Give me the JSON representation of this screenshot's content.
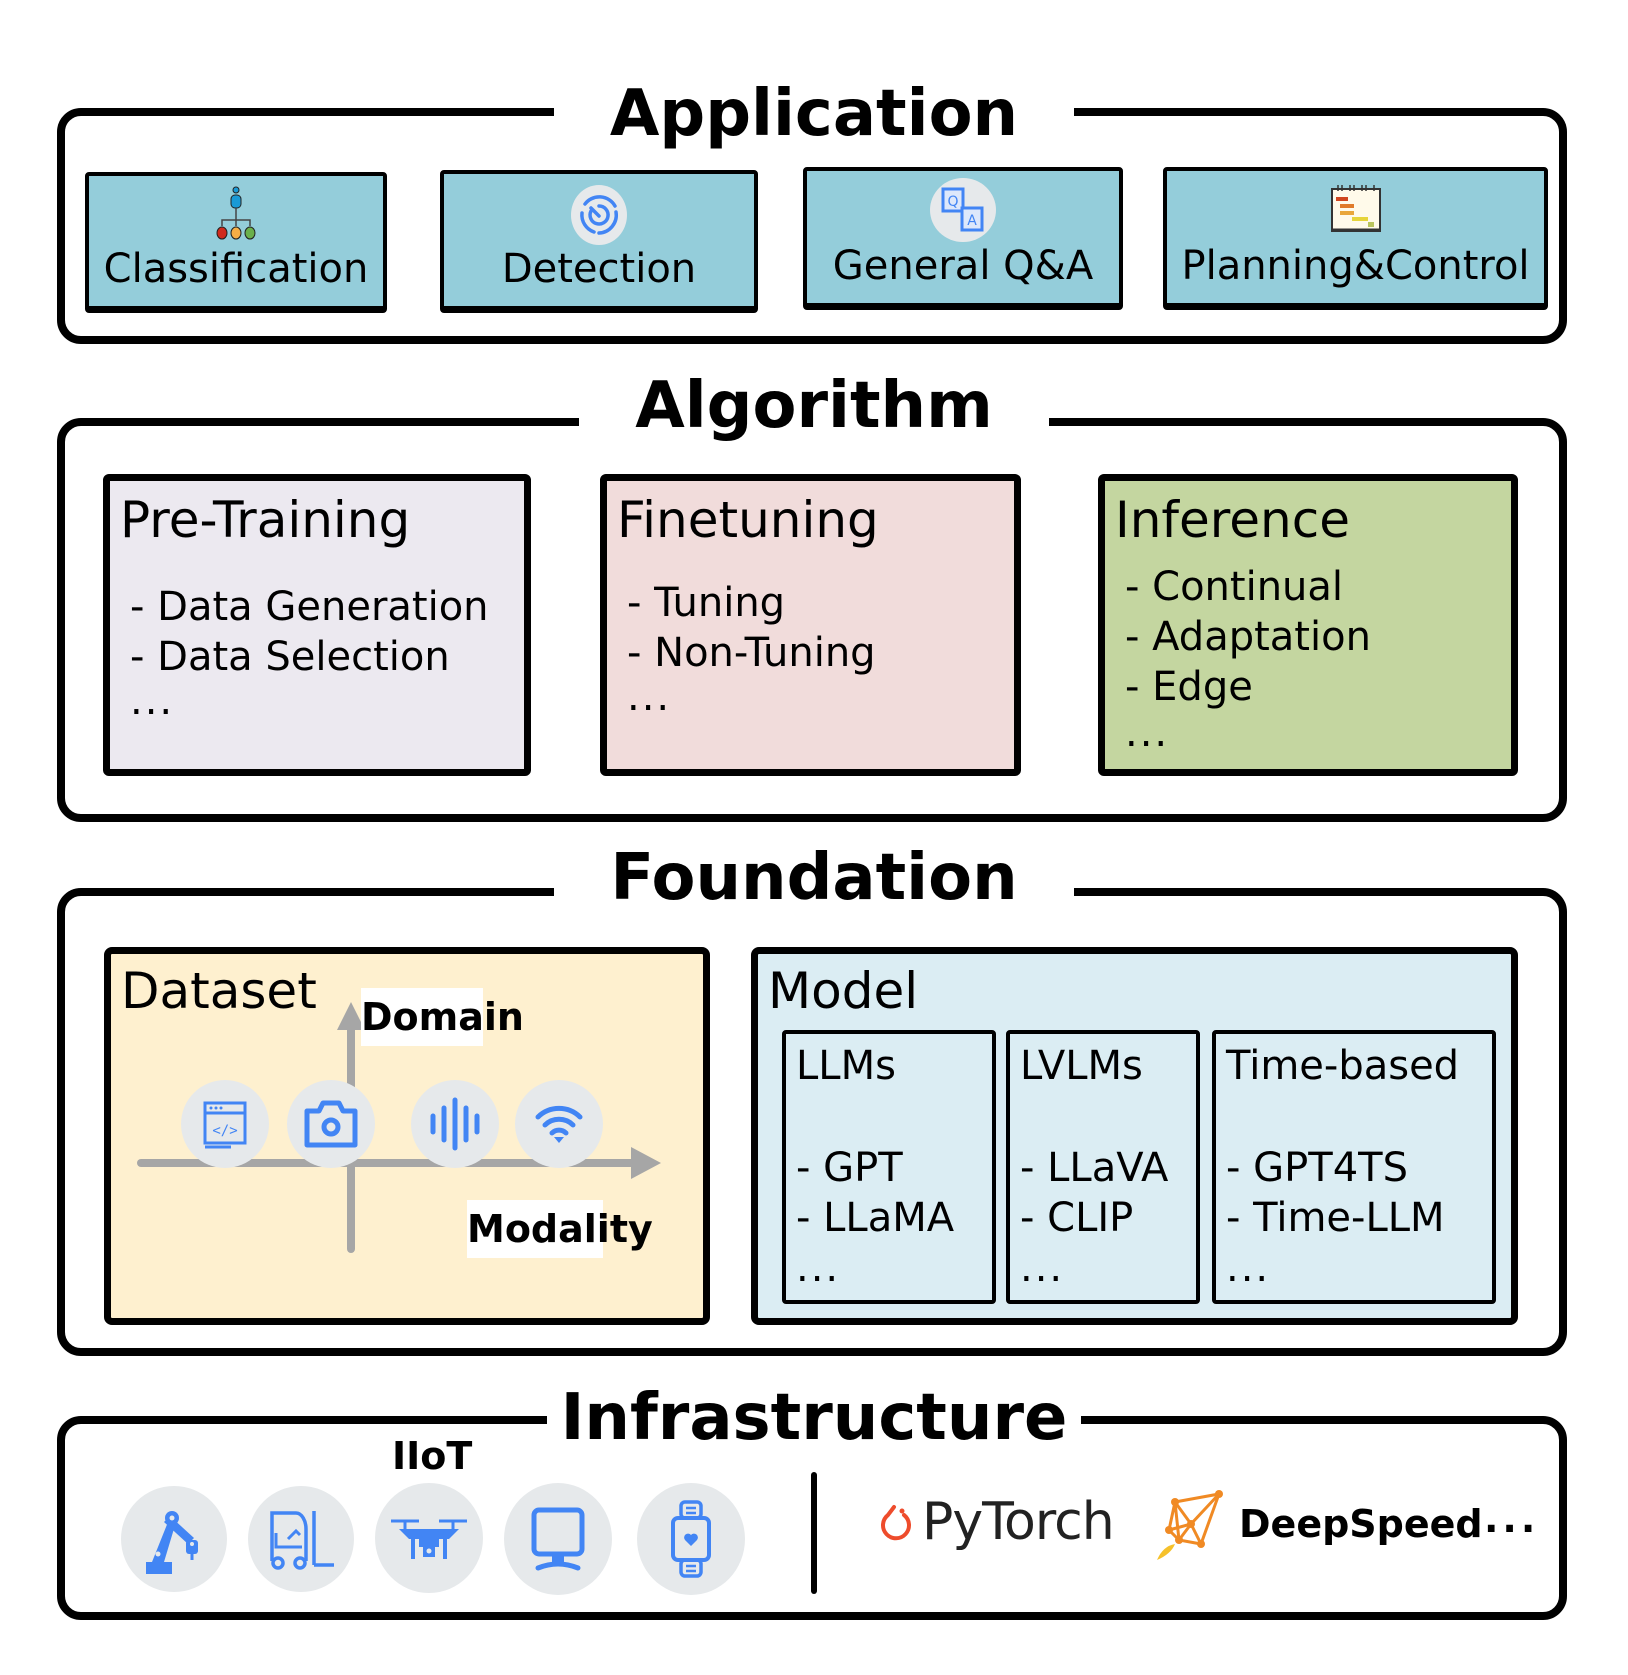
{
  "layers": {
    "application": {
      "title": "Application",
      "items": [
        {
          "label": "Classification",
          "icon": "hierarchy-tree-icon"
        },
        {
          "label": "Detection",
          "icon": "radar-icon"
        },
        {
          "label": "General Q&A",
          "icon": "qa-icon"
        },
        {
          "label": "Planning&Control",
          "icon": "gantt-chart-icon"
        }
      ]
    },
    "algorithm": {
      "title": "Algorithm",
      "boxes": [
        {
          "title": "Pre-Training",
          "items": [
            "- Data Generation",
            "- Data Selection"
          ],
          "more": "..."
        },
        {
          "title": "Finetuning",
          "items": [
            "- Tuning",
            "- Non-Tuning"
          ],
          "more": "..."
        },
        {
          "title": "Inference",
          "items": [
            "- Continual",
            "- Adaptation",
            "- Edge"
          ],
          "more": "..."
        }
      ]
    },
    "foundation": {
      "title": "Foundation",
      "dataset": {
        "title": "Dataset",
        "y_axis_label": "Domain",
        "x_axis_label": "Modality",
        "icons": [
          "code-window-icon",
          "camera-icon",
          "audio-wave-icon",
          "wifi-signal-icon"
        ]
      },
      "model": {
        "title": "Model",
        "groups": [
          {
            "title": "LLMs",
            "items": [
              "- GPT",
              "- LLaMA"
            ],
            "more": "..."
          },
          {
            "title": "LVLMs",
            "items": [
              "- LLaVA",
              "- CLIP"
            ],
            "more": "..."
          },
          {
            "title": "Time-based",
            "items": [
              "- GPT4TS",
              "- Time-LLM"
            ],
            "more": "..."
          }
        ]
      }
    },
    "infrastructure": {
      "title": "Infrastructure",
      "iiot_label": "IIoT",
      "devices": [
        "robot-arm-icon",
        "forklift-icon",
        "drone-icon",
        "monitor-icon",
        "smartwatch-icon"
      ],
      "frameworks": [
        {
          "name": "PyTorch",
          "icon": "pytorch-logo-icon"
        },
        {
          "name": "DeepSpeed",
          "icon": "deepspeed-logo-icon"
        }
      ],
      "more": "..."
    }
  },
  "colors": {
    "application_box": "#94cdda",
    "pretraining_box": "#ece9f0",
    "finetuning_box": "#f1dcdb",
    "inference_box": "#c4d6a0",
    "dataset_box": "#fef0cf",
    "model_box": "#dbedf3",
    "icon_blue": "#4285f4",
    "icon_circle": "#e6e9eb",
    "axis_gray": "#a6a6a6",
    "pytorch": "#ee4c2c",
    "deepspeed": "#f08a24"
  }
}
